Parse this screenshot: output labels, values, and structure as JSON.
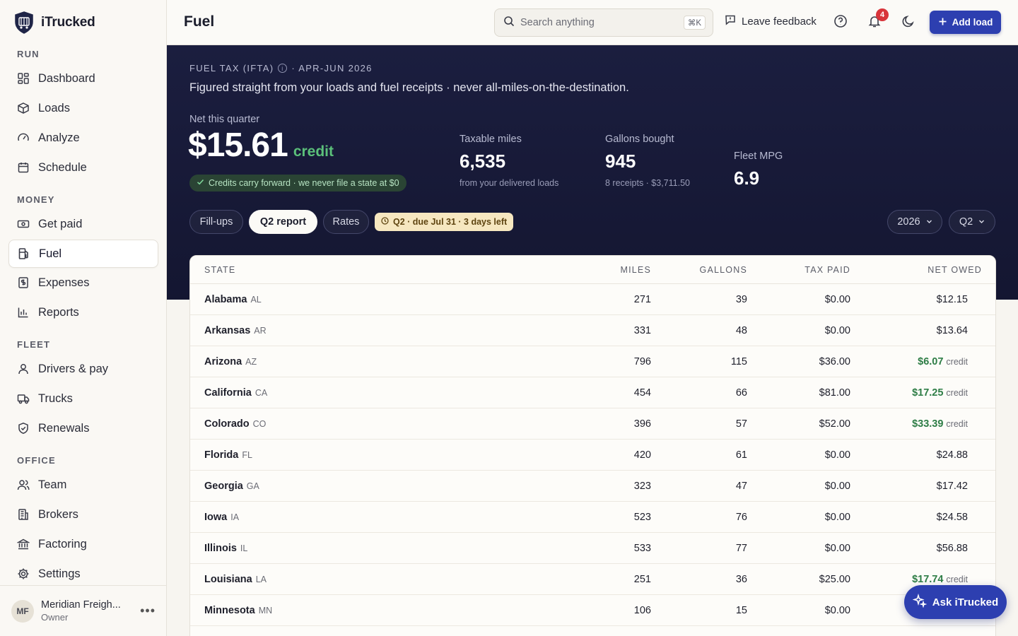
{
  "app": {
    "name": "iTrucked"
  },
  "sidebar": {
    "sections": {
      "run": "RUN",
      "money": "MONEY",
      "fleet": "FLEET",
      "office": "OFFICE"
    },
    "items": {
      "dashboard": "Dashboard",
      "loads": "Loads",
      "analyze": "Analyze",
      "schedule": "Schedule",
      "get_paid": "Get paid",
      "fuel": "Fuel",
      "expenses": "Expenses",
      "reports": "Reports",
      "drivers_pay": "Drivers & pay",
      "trucks": "Trucks",
      "renewals": "Renewals",
      "team": "Team",
      "brokers": "Brokers",
      "factoring": "Factoring",
      "settings": "Settings"
    },
    "active_item": "Fuel",
    "user": {
      "initials": "MF",
      "name": "Meridian Freigh...",
      "role": "Owner",
      "more": "•••"
    }
  },
  "header": {
    "title": "Fuel",
    "search_placeholder": "Search anything",
    "search_shortcut": "⌘K",
    "feedback_label": "Leave feedback",
    "notification_count": "4",
    "add_load_label": "Add load"
  },
  "hero": {
    "eyebrow": "FUEL TAX (IFTA)",
    "period": "· APR-JUN 2026",
    "subtitle": "Figured straight from your loads and fuel receipts · never all-miles-on-the-destination.",
    "net_label": "Net this quarter",
    "net_value": "$15.61",
    "net_suffix": "credit",
    "carry_note": "Credits carry forward · we never file a state at $0",
    "stats": {
      "miles": {
        "label": "Taxable miles",
        "value": "6,535",
        "note": "from your delivered loads"
      },
      "gallons": {
        "label": "Gallons bought",
        "value": "945",
        "note": "8 receipts · $3,711.50"
      },
      "mpg": {
        "label": "Fleet MPG",
        "value": "6.9"
      }
    },
    "tabs": {
      "fillups": "Fill-ups",
      "report": "Q2 report",
      "rates": "Rates"
    },
    "active_tab": "Q2 report",
    "due": "Q2 · due Jul 31 · 3 days left",
    "year": "2026",
    "quarter": "Q2"
  },
  "table": {
    "headers": {
      "state": "STATE",
      "miles": "MILES",
      "gallons": "GALLONS",
      "tax_paid": "TAX PAID",
      "net_owed": "NET OWED"
    },
    "rows": [
      {
        "state": "Alabama",
        "abbr": "AL",
        "miles": "271",
        "gallons": "39",
        "tax_paid": "$0.00",
        "net": "$12.15",
        "credit": ""
      },
      {
        "state": "Arkansas",
        "abbr": "AR",
        "miles": "331",
        "gallons": "48",
        "tax_paid": "$0.00",
        "net": "$13.64",
        "credit": ""
      },
      {
        "state": "Arizona",
        "abbr": "AZ",
        "miles": "796",
        "gallons": "115",
        "tax_paid": "$36.00",
        "net": "$6.07",
        "credit": "credit"
      },
      {
        "state": "California",
        "abbr": "CA",
        "miles": "454",
        "gallons": "66",
        "tax_paid": "$81.00",
        "net": "$17.25",
        "credit": "credit"
      },
      {
        "state": "Colorado",
        "abbr": "CO",
        "miles": "396",
        "gallons": "57",
        "tax_paid": "$52.00",
        "net": "$33.39",
        "credit": "credit"
      },
      {
        "state": "Florida",
        "abbr": "FL",
        "miles": "420",
        "gallons": "61",
        "tax_paid": "$0.00",
        "net": "$24.88",
        "credit": ""
      },
      {
        "state": "Georgia",
        "abbr": "GA",
        "miles": "323",
        "gallons": "47",
        "tax_paid": "$0.00",
        "net": "$17.42",
        "credit": ""
      },
      {
        "state": "Iowa",
        "abbr": "IA",
        "miles": "523",
        "gallons": "76",
        "tax_paid": "$0.00",
        "net": "$24.58",
        "credit": ""
      },
      {
        "state": "Illinois",
        "abbr": "IL",
        "miles": "533",
        "gallons": "77",
        "tax_paid": "$0.00",
        "net": "$56.88",
        "credit": ""
      },
      {
        "state": "Louisiana",
        "abbr": "LA",
        "miles": "251",
        "gallons": "36",
        "tax_paid": "$25.00",
        "net": "$17.74",
        "credit": "credit"
      },
      {
        "state": "Minnesota",
        "abbr": "MN",
        "miles": "106",
        "gallons": "15",
        "tax_paid": "$0.00",
        "net": "",
        "credit": ""
      }
    ]
  },
  "assistant": {
    "label": "Ask iTrucked"
  },
  "colors": {
    "brand": "#2d3fb0",
    "hero_bg": "#1b1e3f",
    "credit_green": "#2e7d46",
    "due_bg": "#f6e7c0",
    "notif_red": "#d8343a"
  }
}
